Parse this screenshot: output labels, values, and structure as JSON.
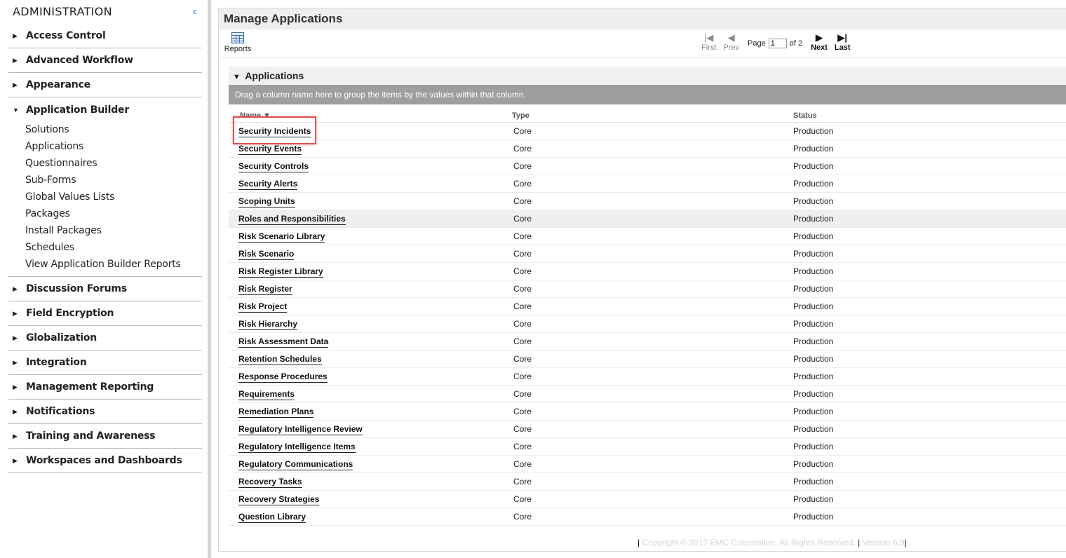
{
  "sidebar": {
    "title": "ADMINISTRATION",
    "collapse_icon": "‹",
    "items": [
      {
        "label": "Access Control"
      },
      {
        "label": "Advanced Workflow"
      },
      {
        "label": "Appearance"
      },
      {
        "label": "Application Builder",
        "open": true,
        "children": [
          "Solutions",
          "Applications",
          "Questionnaires",
          "Sub-Forms",
          "Global Values Lists",
          "Packages",
          "Install Packages",
          "Schedules",
          "View Application Builder Reports"
        ]
      },
      {
        "label": "Discussion Forums"
      },
      {
        "label": "Field Encryption"
      },
      {
        "label": "Globalization"
      },
      {
        "label": "Integration"
      },
      {
        "label": "Management Reporting"
      },
      {
        "label": "Notifications"
      },
      {
        "label": "Training and Awareness"
      },
      {
        "label": "Workspaces and Dashboards"
      }
    ]
  },
  "main": {
    "title": "Manage Applications",
    "toolbar": {
      "reports_label": "Reports",
      "pager": {
        "first_label": "First",
        "prev_label": "Prev",
        "page_label": "Page",
        "page_value": "1",
        "of_label": "of 2",
        "next_label": "Next",
        "last_label": "Last"
      }
    },
    "section_title": "Applications",
    "group_hint": "Drag a column name here to group the items by the values within that column.",
    "columns": {
      "name": "Name",
      "name_sort_icon": "▼",
      "type": "Type",
      "status": "Status"
    },
    "rows": [
      {
        "name": "Security Incidents",
        "type": "Core",
        "status": "Production"
      },
      {
        "name": "Security Events",
        "type": "Core",
        "status": "Production"
      },
      {
        "name": "Security Controls",
        "type": "Core",
        "status": "Production"
      },
      {
        "name": "Security Alerts",
        "type": "Core",
        "status": "Production"
      },
      {
        "name": "Scoping Units",
        "type": "Core",
        "status": "Production"
      },
      {
        "name": "Roles and Responsibilities",
        "type": "Core",
        "status": "Production"
      },
      {
        "name": "Risk Scenario Library",
        "type": "Core",
        "status": "Production"
      },
      {
        "name": "Risk Scenario",
        "type": "Core",
        "status": "Production"
      },
      {
        "name": "Risk Register Library",
        "type": "Core",
        "status": "Production"
      },
      {
        "name": "Risk Register",
        "type": "Core",
        "status": "Production"
      },
      {
        "name": "Risk Project",
        "type": "Core",
        "status": "Production"
      },
      {
        "name": "Risk Hierarchy",
        "type": "Core",
        "status": "Production"
      },
      {
        "name": "Risk Assessment Data",
        "type": "Core",
        "status": "Production"
      },
      {
        "name": "Retention Schedules",
        "type": "Core",
        "status": "Production"
      },
      {
        "name": "Response Procedures",
        "type": "Core",
        "status": "Production"
      },
      {
        "name": "Requirements",
        "type": "Core",
        "status": "Production"
      },
      {
        "name": "Remediation Plans",
        "type": "Core",
        "status": "Production"
      },
      {
        "name": "Regulatory Intelligence Review",
        "type": "Core",
        "status": "Production"
      },
      {
        "name": "Regulatory Intelligence Items",
        "type": "Core",
        "status": "Production"
      },
      {
        "name": "Regulatory Communications",
        "type": "Core",
        "status": "Production"
      },
      {
        "name": "Recovery Tasks",
        "type": "Core",
        "status": "Production"
      },
      {
        "name": "Recovery Strategies",
        "type": "Core",
        "status": "Production"
      },
      {
        "name": "Question Library",
        "type": "Core",
        "status": "Production"
      }
    ],
    "footer": {
      "copyright": "Copyright © 2017 EMC Corporation.  All Rights Reserved.",
      "version": "Version 6.9"
    }
  }
}
